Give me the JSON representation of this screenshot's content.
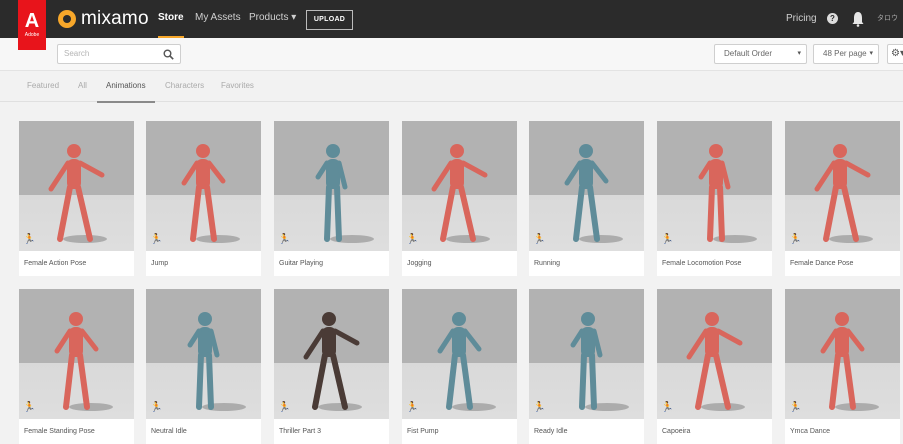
{
  "header": {
    "adobe_logo": "A",
    "adobe_text": "Adobe",
    "brand": "mixamo",
    "nav": [
      "Store",
      "My Assets",
      "Products ▾"
    ],
    "upload": "UPLOAD",
    "pricing": "Pricing",
    "user": "タロウ"
  },
  "toolbar": {
    "search_placeholder": "Search",
    "sort": "Default Order",
    "per_page": "48 Per page",
    "caret": "▾",
    "gear": "⚙▾"
  },
  "tabs": [
    "Featured",
    "All",
    "Animations",
    "Characters",
    "Favorites"
  ],
  "active_tab": "Animations",
  "colors": {
    "accent": "#f7a72a",
    "adobe_red": "#e8141b",
    "female_model": "#d9665c",
    "male_model": "#5f8c99",
    "zombie_model": "#4a3b36"
  },
  "cards": [
    {
      "title": "Female Action Pose",
      "model": "female"
    },
    {
      "title": "Jump",
      "model": "female"
    },
    {
      "title": "Guitar Playing",
      "model": "male"
    },
    {
      "title": "Jogging",
      "model": "female"
    },
    {
      "title": "Running",
      "model": "male"
    },
    {
      "title": "Female Locomotion Pose",
      "model": "female"
    },
    {
      "title": "Female Dance Pose",
      "model": "female"
    },
    {
      "title": "Female Standing Pose",
      "model": "female"
    },
    {
      "title": "Neutral Idle",
      "model": "male"
    },
    {
      "title": "Thriller Part 3",
      "model": "zombie"
    },
    {
      "title": "Fist Pump",
      "model": "male"
    },
    {
      "title": "Ready Idle",
      "model": "male"
    },
    {
      "title": "Capoeira",
      "model": "female"
    },
    {
      "title": "Ymca Dance",
      "model": "female"
    }
  ],
  "card_icon": "★"
}
